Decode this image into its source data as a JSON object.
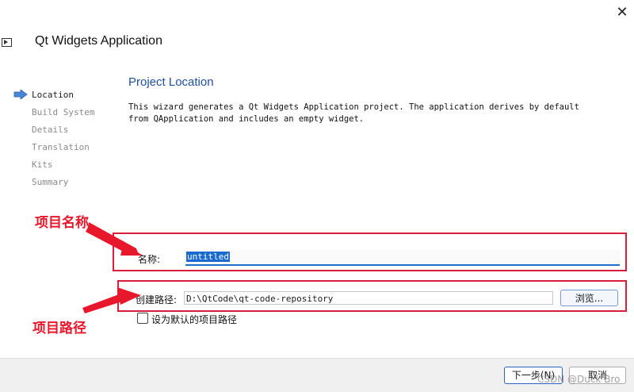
{
  "window": {
    "title": "Qt Widgets Application",
    "close_glyph": "✕",
    "app_icon": "qt-creator-icon"
  },
  "sidebar": {
    "items": [
      {
        "label": "Location",
        "active": true
      },
      {
        "label": "Build System",
        "active": false
      },
      {
        "label": "Details",
        "active": false
      },
      {
        "label": "Translation",
        "active": false
      },
      {
        "label": "Kits",
        "active": false
      },
      {
        "label": "Summary",
        "active": false
      }
    ]
  },
  "main": {
    "heading": "Project Location",
    "description": "This wizard generates a Qt Widgets Application project. The application derives by default from QApplication and includes an empty widget.",
    "name_label": "名称:",
    "name_value": "untitled",
    "path_label": "创建路径:",
    "path_value": "D:\\QtCode\\qt-code-repository",
    "browse_label": "浏览...",
    "default_path_label": "设为默认的项目路径",
    "default_path_checked": false
  },
  "annotations": {
    "name_callout": "项目名称",
    "path_callout": "项目路径",
    "color": "#e8182c"
  },
  "footer": {
    "next_label": "下一步(N)",
    "cancel_label": "取消"
  },
  "watermark": "CSDN @Duck Bro",
  "colors": {
    "accent": "#1f4e9c",
    "annotation_red": "#d71f3a",
    "selection": "#1b6ad0"
  }
}
